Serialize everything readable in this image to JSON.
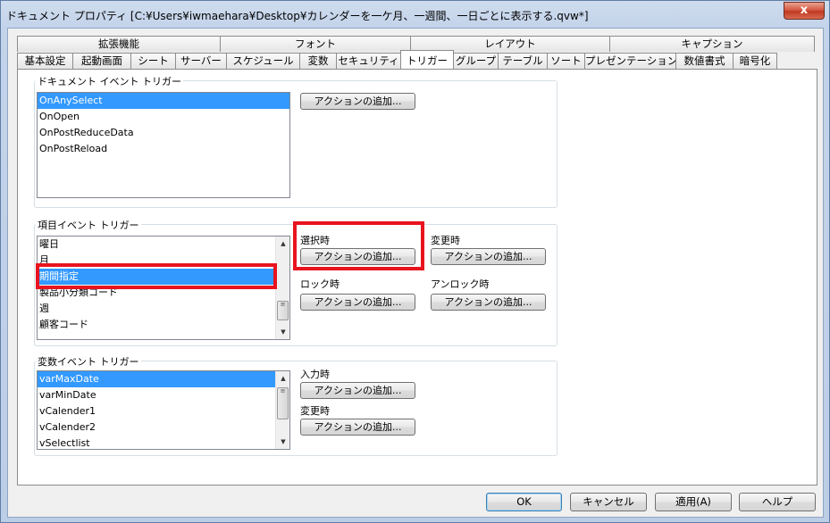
{
  "window": {
    "title": "ドキュメント プロパティ [C:¥Users¥iwmaehara¥Desktop¥カレンダーを一ケ月、一週間、一日ごとに表示する.qvw*]",
    "close_glyph": "x"
  },
  "tabs": {
    "row_top": [
      "拡張機能",
      "フォント",
      "レイアウト",
      "キャプション"
    ],
    "row_bottom": [
      "基本設定",
      "起動画面",
      "シート",
      "サーバー",
      "スケジュール",
      "変数",
      "セキュリティ",
      "トリガー",
      "グループ",
      "テーブル",
      "ソート",
      "プレゼンテーション",
      "数値書式",
      "暗号化"
    ],
    "active": "トリガー"
  },
  "document_triggers": {
    "label": "ドキュメント イベント トリガー",
    "items": [
      "OnAnySelect",
      "OnOpen",
      "OnPostReduceData",
      "OnPostReload"
    ],
    "selected": "OnAnySelect",
    "add_action": "アクションの追加..."
  },
  "field_triggers": {
    "label": "項目イベント トリガー",
    "items": [
      "曜日",
      "月",
      "期間指定",
      "製品小分類コード",
      "週",
      "顧客コード"
    ],
    "selected": "期間指定",
    "on_select_label": "選択時",
    "on_change_label": "変更時",
    "on_lock_label": "ロック時",
    "on_unlock_label": "アンロック時",
    "add_action": "アクションの追加..."
  },
  "variable_triggers": {
    "label": "変数イベント トリガー",
    "items": [
      "varMaxDate",
      "varMinDate",
      "vCalender1",
      "vCalender2",
      "vSelectlist"
    ],
    "selected": "varMaxDate",
    "on_input_label": "入力時",
    "on_change_label": "変更時",
    "add_action": "アクションの追加..."
  },
  "footer": {
    "ok": "OK",
    "cancel": "キャンセル",
    "apply": "適用(A)",
    "help": "ヘルプ"
  },
  "colors": {
    "highlight": "#e8141e",
    "selection": "#3399ff"
  }
}
